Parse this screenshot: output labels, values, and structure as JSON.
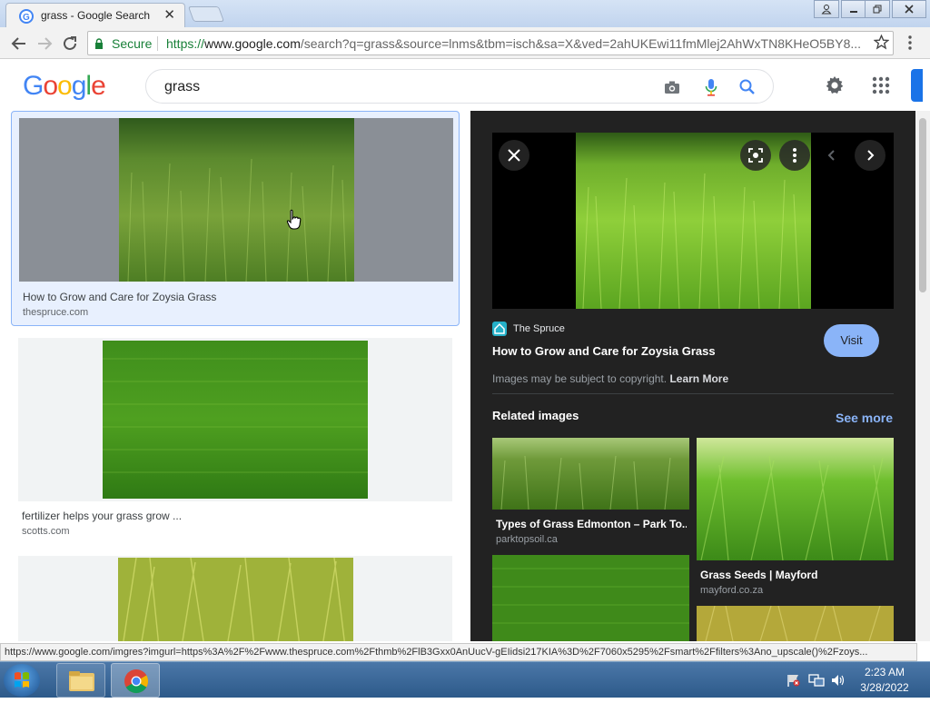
{
  "browser": {
    "tab_title": "grass - Google Search",
    "tab_close": "✕",
    "secure_label": "Secure",
    "url_scheme": "https://",
    "url_host": "www.google.com",
    "url_rest": "/search?q=grass&source=lnms&tbm=isch&sa=X&ved=2ahUKEwi11fmMlej2AhWxTN8KHeO5BY8...",
    "window_buttons": [
      "user",
      "minimize",
      "restore",
      "close"
    ]
  },
  "google": {
    "logo_letters": [
      {
        "ch": "G",
        "color": "#4285F4"
      },
      {
        "ch": "o",
        "color": "#EA4335"
      },
      {
        "ch": "o",
        "color": "#FBBC05"
      },
      {
        "ch": "g",
        "color": "#4285F4"
      },
      {
        "ch": "l",
        "color": "#34A853"
      },
      {
        "ch": "e",
        "color": "#EA4335"
      }
    ],
    "search_query": "grass"
  },
  "results": [
    {
      "title": "How to Grow and Care for Zoysia Grass",
      "source": "thespruce.com",
      "selected": true
    },
    {
      "title": "fertilizer helps your grass grow ...",
      "source": "scotts.com",
      "selected": false
    },
    {
      "title": "",
      "source": "",
      "selected": false
    }
  ],
  "preview": {
    "source_name": "The Spruce",
    "title": "How to Grow and Care for Zoysia Grass",
    "visit_label": "Visit",
    "copyright_text": "Images may be subject to copyright.",
    "learn_more": "Learn More",
    "related_heading": "Related images",
    "see_more": "See more",
    "related": [
      {
        "title": "Types of Grass Edmonton – Park To...",
        "source": "parktopsoil.ca"
      },
      {
        "title": "Grass Seeds | Mayford",
        "source": "mayford.co.za"
      },
      {
        "title": "",
        "source": ""
      },
      {
        "title": "",
        "source": ""
      }
    ]
  },
  "status_url": "https://www.google.com/imgres?imgurl=https%3A%2F%2Fwww.thespruce.com%2Fthmb%2FlB3Gxx0AnUucV-gEIidsi217KIA%3D%2F7060x5295%2Fsmart%2Ffilters%3Ano_upscale()%2Fzoys...",
  "taskbar": {
    "time": "2:23 AM",
    "date": "3/28/2022"
  },
  "colors": {
    "accent": "#1a73e8",
    "panel_bg": "#222222",
    "visit_button": "#8ab4f8",
    "secure_green": "#188038"
  }
}
